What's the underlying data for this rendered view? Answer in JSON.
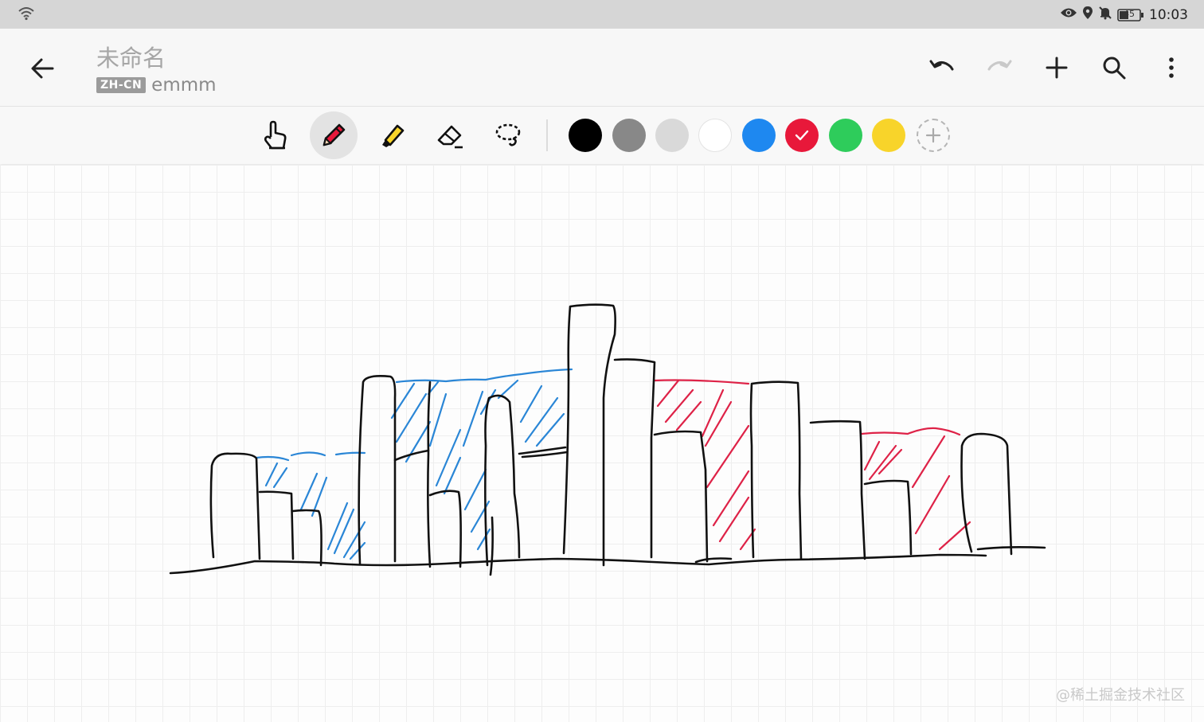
{
  "status_bar": {
    "time": "10:03",
    "battery": "45",
    "icons": [
      "wifi-icon",
      "eye-icon",
      "location-icon",
      "mute-bell-icon",
      "battery-icon"
    ]
  },
  "app_bar": {
    "title": "未命名",
    "lang_badge": "ZH-CN",
    "doc_label": "emmm",
    "actions": [
      "undo-icon",
      "redo-icon",
      "add-icon",
      "search-icon",
      "more-icon"
    ]
  },
  "toolbar": {
    "tools": [
      "hand-tool",
      "pen-tool",
      "highlighter-tool",
      "eraser-tool",
      "lasso-tool"
    ],
    "active_tool": "pen-tool",
    "colors": [
      "#000000",
      "#888888",
      "#d9d9d9",
      "#ffffff",
      "#1e88f0",
      "#e8183a",
      "#2ecc5b",
      "#f8d42a"
    ],
    "selected_color": "#e8183a"
  },
  "canvas": {
    "ink_colors": {
      "black": "#111111",
      "blue": "#2a86d6",
      "red": "#de2247"
    }
  },
  "watermark": "@稀土掘金技术社区"
}
